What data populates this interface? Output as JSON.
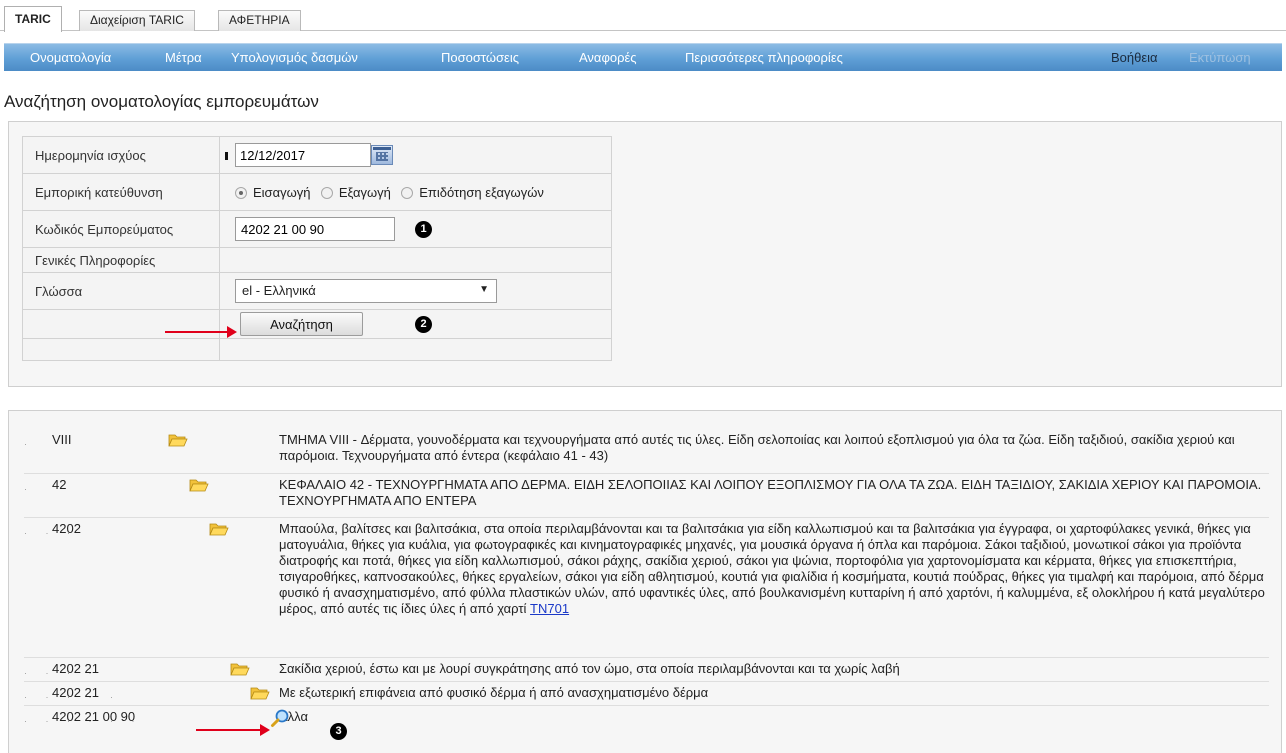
{
  "tabs": [
    {
      "label": "TARIC",
      "active": true
    },
    {
      "label": "Διαχείριση TARIC",
      "active": false
    },
    {
      "label": "ΑΦΕΤΗΡΙΑ",
      "active": false
    }
  ],
  "menu": {
    "items": [
      "Ονοματολογία",
      "Μέτρα",
      "Υπολογισμός δασμών",
      "Ποσοστώσεις",
      "Αναφορές",
      "Περισσότερες πληροφορίες"
    ],
    "help": "Βοήθεια",
    "print": "Εκτύπωση"
  },
  "page_title": "Αναζήτηση ονοματολογίας εμπορευμάτων",
  "form": {
    "date_label": "Ημερομηνία ισχύος",
    "date_value": "12/12/2017",
    "direction_label": "Εμπορική κατεύθυνση",
    "direction_options": [
      "Εισαγωγή",
      "Εξαγωγή",
      "Επιδότηση εξαγωγών"
    ],
    "direction_selected": "Εισαγωγή",
    "code_label": "Κωδικός Εμπορεύματος",
    "code_value": "4202 21 00 90",
    "general_info_label": "Γενικές Πληροφορίες",
    "language_label": "Γλώσσα",
    "language_value": "el - Ελληνικά",
    "search_button": "Αναζήτηση"
  },
  "annotations": {
    "badge1": "1",
    "badge2": "2",
    "badge3": "3"
  },
  "results": [
    {
      "code": "VIII",
      "icon": "folder-open-icon",
      "description": "ΤΜΗΜΑ VIII - Δέρματα, γουνοδέρματα και τεχνουργήματα από αυτές τις ύλες. Είδη σελοποιίας και λοιπού εξοπλισμού για όλα τα ζώα. Είδη ταξιδιού, σακίδια χεριού και παρόμοια. Τεχνουργήματα από έντερα (κεφάλαιο 41 - 43)"
    },
    {
      "code": "42",
      "icon": "folder-open-icon",
      "description": "ΚΕΦΑΛΑΙΟ 42 - ΤΕΧΝΟΥΡΓΗΜΑΤΑ ΑΠΟ ΔΕΡΜΑ. ΕΙΔΗ ΣΕΛΟΠΟΙΙΑΣ ΚΑΙ ΛΟΙΠΟΥ ΕΞΟΠΛΙΣΜΟΥ ΓΙΑ ΟΛΑ ΤΑ ΖΩΑ. ΕΙΔΗ ΤΑΞΙΔΙΟΥ, ΣΑΚΙΔΙΑ ΧΕΡΙΟΥ ΚΑΙ ΠΑΡΟΜΟΙΑ. ΤΕΧΝΟΥΡΓΗΜΑΤΑ ΑΠΟ ΕΝΤΕΡΑ"
    },
    {
      "code": "4202",
      "icon": "folder-open-icon",
      "description": "Μπαούλα, βαλίτσες και βαλιτσάκια, στα οποία περιλαμβάνονται και τα βαλιτσάκια για είδη καλλωπισμού και τα βαλιτσάκια για έγγραφα, οι χαρτοφύλακες γενικά, θήκες για ματογυάλια, θήκες για κυάλια, για φωτογραφικές και κινηματογραφικές μηχανές, για μουσικά όργανα ή όπλα και παρόμοια. Σάκοι ταξιδιού, μονωτικοί σάκοι για προϊόντα διατροφής και ποτά, θήκες για είδη καλλωπισμού, σάκοι ράχης, σακίδια χεριού, σάκοι για ψώνια, πορτοφόλια για χαρτονομίσματα και κέρματα, θήκες για επισκεπτήρια, τσιγαροθήκες, καπνοσακούλες, θήκες εργαλείων, σάκοι για είδη αθλητισμού, κουτιά για φιαλίδια ή κοσμήματα, κουτιά πούδρας, θήκες για τιμαλφή και παρόμοια, από δέρμα φυσικό ή ανασχηματισμένο, από φύλλα πλαστικών υλών, από υφαντικές ύλες, από βουλκανισμένη κυτταρίνη ή από χαρτόνι, ή καλυμμένα, εξ ολοκλήρου ή κατά μεγαλύτερο μέρος, από αυτές τις ίδιες ύλες ή από χαρτί",
      "link": "TN701"
    },
    {
      "code": "4202 21",
      "icon": "folder-open-icon",
      "description": "Σακίδια χεριού, έστω και με λουρί συγκράτησης από τον ώμο, στα οποία περιλαμβάνονται και τα χωρίς λαβή"
    },
    {
      "code": "4202 21",
      "icon": "folder-open-icon",
      "description": "Με εξωτερική επιφάνεια από φυσικό δέρμα ή από ανασχηματισμένο δέρμα"
    },
    {
      "code": "4202 21 00 90",
      "icon": "magnifier-icon",
      "description": "Άλλα"
    }
  ]
}
